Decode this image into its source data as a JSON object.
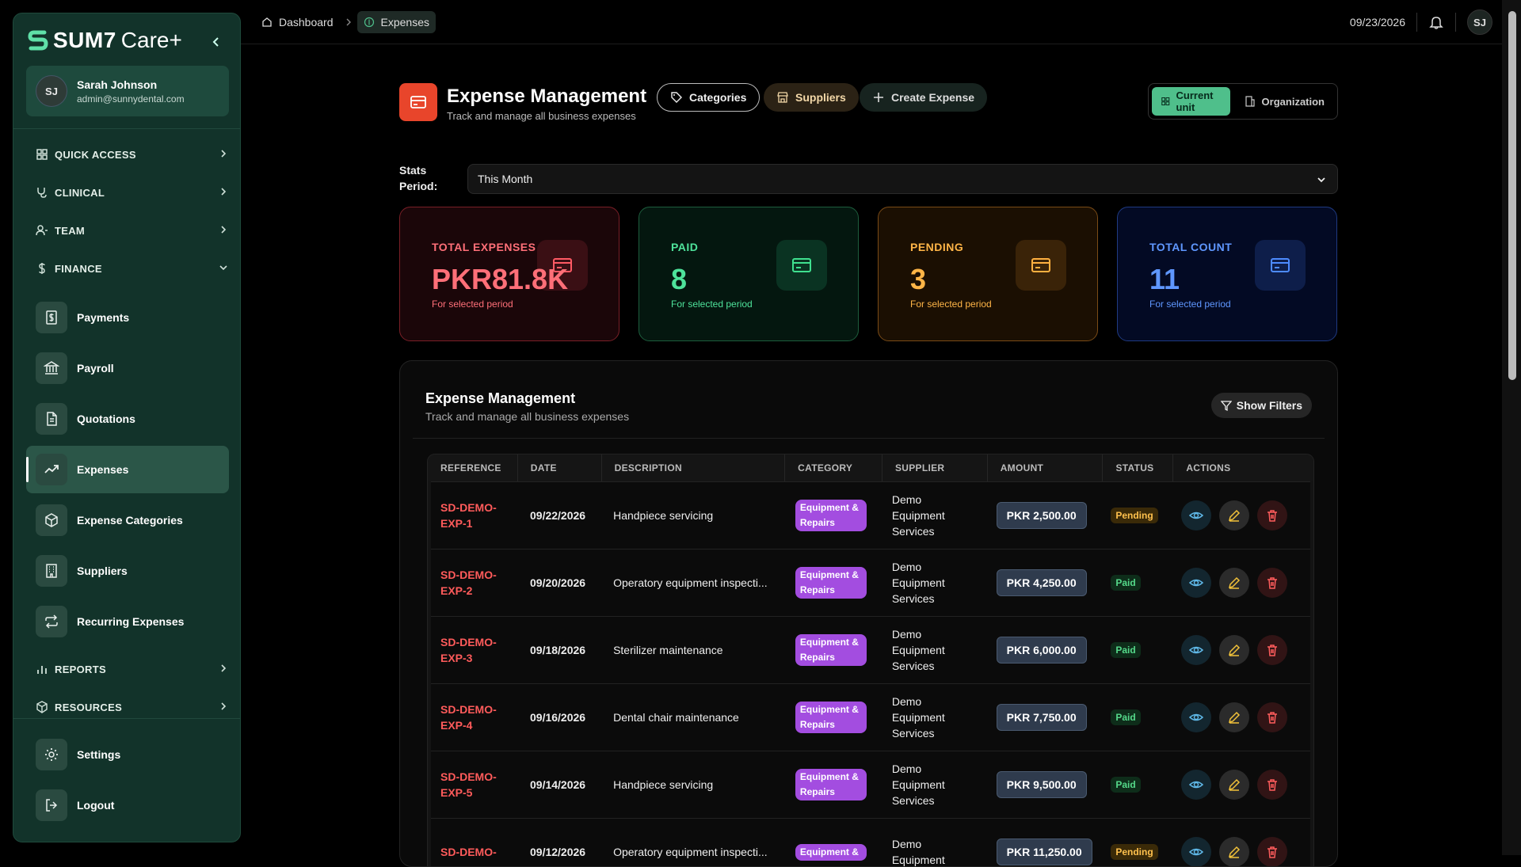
{
  "app": {
    "brand": "SUM7",
    "product": "Care+"
  },
  "user": {
    "initials": "SJ",
    "name": "Sarah Johnson",
    "email": "admin@sunnydental.com"
  },
  "sidebar": {
    "sections": [
      {
        "label": "QUICK ACCESS",
        "icon": "grid-icon"
      },
      {
        "label": "CLINICAL",
        "icon": "stethoscope-icon"
      },
      {
        "label": "TEAM",
        "icon": "users-icon"
      },
      {
        "label": "FINANCE",
        "icon": "dollar-icon"
      },
      {
        "label": "REPORTS",
        "icon": "bar-chart-icon"
      },
      {
        "label": "RESOURCES",
        "icon": "box-icon"
      }
    ],
    "finance_items": [
      {
        "label": "Payments",
        "icon": "receipt-icon"
      },
      {
        "label": "Payroll",
        "icon": "bank-icon"
      },
      {
        "label": "Quotations",
        "icon": "document-icon"
      },
      {
        "label": "Expenses",
        "icon": "trend-up-icon",
        "active": true
      },
      {
        "label": "Expense Categories",
        "icon": "package-icon"
      },
      {
        "label": "Suppliers",
        "icon": "building-icon"
      },
      {
        "label": "Recurring Expenses",
        "icon": "repeat-icon"
      }
    ],
    "bottom_items": [
      {
        "label": "Settings",
        "icon": "gear-icon"
      },
      {
        "label": "Logout",
        "icon": "logout-icon"
      }
    ]
  },
  "breadcrumb": {
    "home": "Dashboard",
    "current": "Expenses"
  },
  "topbar": {
    "date": "09/23/2026",
    "initials": "SJ"
  },
  "header": {
    "title": "Expense Management",
    "subtitle": "Track and manage all business expenses",
    "categories_label": "Categories",
    "suppliers_label": "Suppliers",
    "create_label": "Create Expense",
    "scope_current": "Current unit",
    "scope_org": "Organization"
  },
  "stats_period": {
    "label_line1": "Stats",
    "label_line2": "Period:",
    "value": "This Month"
  },
  "stats": [
    {
      "title": "TOTAL EXPENSES",
      "value": "PKR81.8K",
      "sub": "For selected period"
    },
    {
      "title": "PAID",
      "value": "8",
      "sub": "For selected period"
    },
    {
      "title": "PENDING",
      "value": "3",
      "sub": "For selected period"
    },
    {
      "title": "TOTAL COUNT",
      "value": "11",
      "sub": "For selected period"
    }
  ],
  "table": {
    "title": "Expense Management",
    "subtitle": "Track and manage all business expenses",
    "filter_label": "Show Filters",
    "columns": [
      "REFERENCE",
      "DATE",
      "DESCRIPTION",
      "CATEGORY",
      "SUPPLIER",
      "AMOUNT",
      "STATUS",
      "ACTIONS"
    ],
    "rows": [
      {
        "ref1": "SD-DEMO-",
        "ref2": "EXP-1",
        "date": "09/22/2026",
        "desc": "Handpiece servicing",
        "cat1": "Equipment &",
        "cat2": "Repairs",
        "sup1": "Demo",
        "sup2": "Equipment",
        "sup3": "Services",
        "amount": "PKR 2,500.00",
        "status": "Pending"
      },
      {
        "ref1": "SD-DEMO-",
        "ref2": "EXP-2",
        "date": "09/20/2026",
        "desc": "Operatory equipment inspecti...",
        "cat1": "Equipment &",
        "cat2": "Repairs",
        "sup1": "Demo",
        "sup2": "Equipment",
        "sup3": "Services",
        "amount": "PKR 4,250.00",
        "status": "Paid"
      },
      {
        "ref1": "SD-DEMO-",
        "ref2": "EXP-3",
        "date": "09/18/2026",
        "desc": "Sterilizer maintenance",
        "cat1": "Equipment &",
        "cat2": "Repairs",
        "sup1": "Demo",
        "sup2": "Equipment",
        "sup3": "Services",
        "amount": "PKR 6,000.00",
        "status": "Paid"
      },
      {
        "ref1": "SD-DEMO-",
        "ref2": "EXP-4",
        "date": "09/16/2026",
        "desc": "Dental chair maintenance",
        "cat1": "Equipment &",
        "cat2": "Repairs",
        "sup1": "Demo",
        "sup2": "Equipment",
        "sup3": "Services",
        "amount": "PKR 7,750.00",
        "status": "Paid"
      },
      {
        "ref1": "SD-DEMO-",
        "ref2": "EXP-5",
        "date": "09/14/2026",
        "desc": "Handpiece servicing",
        "cat1": "Equipment &",
        "cat2": "Repairs",
        "sup1": "Demo",
        "sup2": "Equipment",
        "sup3": "Services",
        "amount": "PKR 9,500.00",
        "status": "Paid"
      },
      {
        "ref1": "SD-DEMO-",
        "ref2": "",
        "date": "09/12/2026",
        "desc": "Operatory equipment inspecti...",
        "cat1": "Equipment &",
        "cat2": "",
        "sup1": "Demo",
        "sup2": "Equipment",
        "sup3": "",
        "amount": "PKR 11,250.00",
        "status": "Pending"
      }
    ]
  }
}
